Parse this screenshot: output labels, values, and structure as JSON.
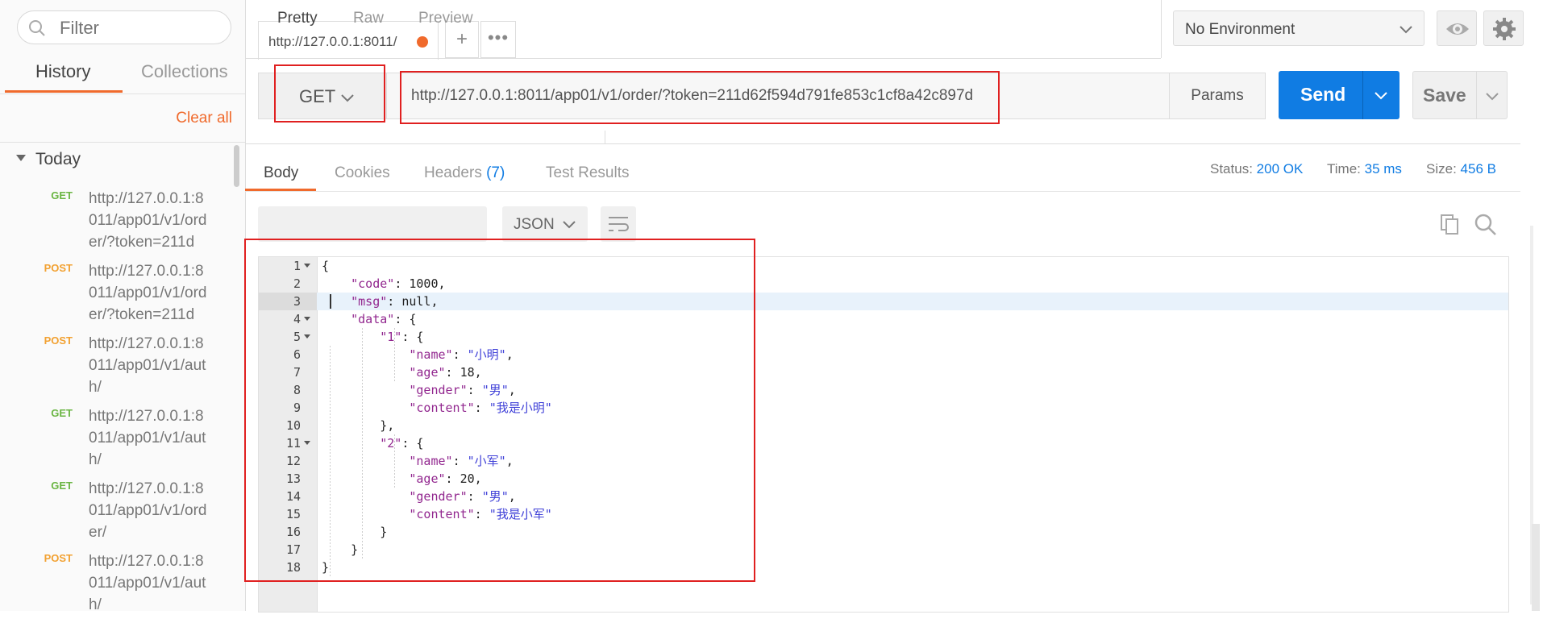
{
  "sidebar": {
    "filter_placeholder": "Filter",
    "tabs": [
      "History",
      "Collections"
    ],
    "clear_all": "Clear all",
    "group_label": "Today",
    "items": [
      {
        "method": "GET",
        "url": "http://127.0.0.1:8011/app01/v1/order/?token=211d"
      },
      {
        "method": "POST",
        "url": "http://127.0.0.1:8011/app01/v1/order/?token=211d"
      },
      {
        "method": "POST",
        "url": "http://127.0.0.1:8011/app01/v1/auth/"
      },
      {
        "method": "GET",
        "url": "http://127.0.0.1:8011/app01/v1/auth/"
      },
      {
        "method": "GET",
        "url": "http://127.0.0.1:8011/app01/v1/order/"
      },
      {
        "method": "POST",
        "url": "http://127.0.0.1:8011/app01/v1/auth/"
      }
    ]
  },
  "tabbar": {
    "active_tab": "http://127.0.0.1:8011/",
    "plus": "+",
    "more": "•••"
  },
  "environment": {
    "selected": "No Environment"
  },
  "request": {
    "method": "GET",
    "url": "http://127.0.0.1:8011/app01/v1/order/?token=211d62f594d791fe853c1cf8a42c897d",
    "params_label": "Params",
    "send_label": "Send",
    "save_label": "Save"
  },
  "response": {
    "tabs": {
      "body": "Body",
      "cookies": "Cookies",
      "headers": "Headers",
      "headers_count": "(7)",
      "tests": "Test Results"
    },
    "status_label": "Status:",
    "status_value": "200 OK",
    "time_label": "Time:",
    "time_value": "35 ms",
    "size_label": "Size:",
    "size_value": "456 B",
    "formats": [
      "Pretty",
      "Raw",
      "Preview"
    ],
    "language": "JSON"
  },
  "colors": {
    "accent": "#f06a2c",
    "send_blue": "#107ce3",
    "highlight_red": "#e02020",
    "get_green": "#6ab543",
    "post_orange": "#f2a131"
  },
  "code_lines": [
    {
      "n": "1",
      "text": "{"
    },
    {
      "n": "2",
      "text": "    \"code\": 1000,"
    },
    {
      "n": "3",
      "text": "    \"msg\": null,"
    },
    {
      "n": "4",
      "text": "    \"data\": {"
    },
    {
      "n": "5",
      "text": "        \"1\": {"
    },
    {
      "n": "6",
      "text": "            \"name\": \"小明\","
    },
    {
      "n": "7",
      "text": "            \"age\": 18,"
    },
    {
      "n": "8",
      "text": "            \"gender\": \"男\","
    },
    {
      "n": "9",
      "text": "            \"content\": \"我是小明\""
    },
    {
      "n": "10",
      "text": "        },"
    },
    {
      "n": "11",
      "text": "        \"2\": {"
    },
    {
      "n": "12",
      "text": "            \"name\": \"小军\","
    },
    {
      "n": "13",
      "text": "            \"age\": 20,"
    },
    {
      "n": "14",
      "text": "            \"gender\": \"男\","
    },
    {
      "n": "15",
      "text": "            \"content\": \"我是小军\""
    },
    {
      "n": "16",
      "text": "        }"
    },
    {
      "n": "17",
      "text": "    }"
    },
    {
      "n": "18",
      "text": "}"
    }
  ]
}
